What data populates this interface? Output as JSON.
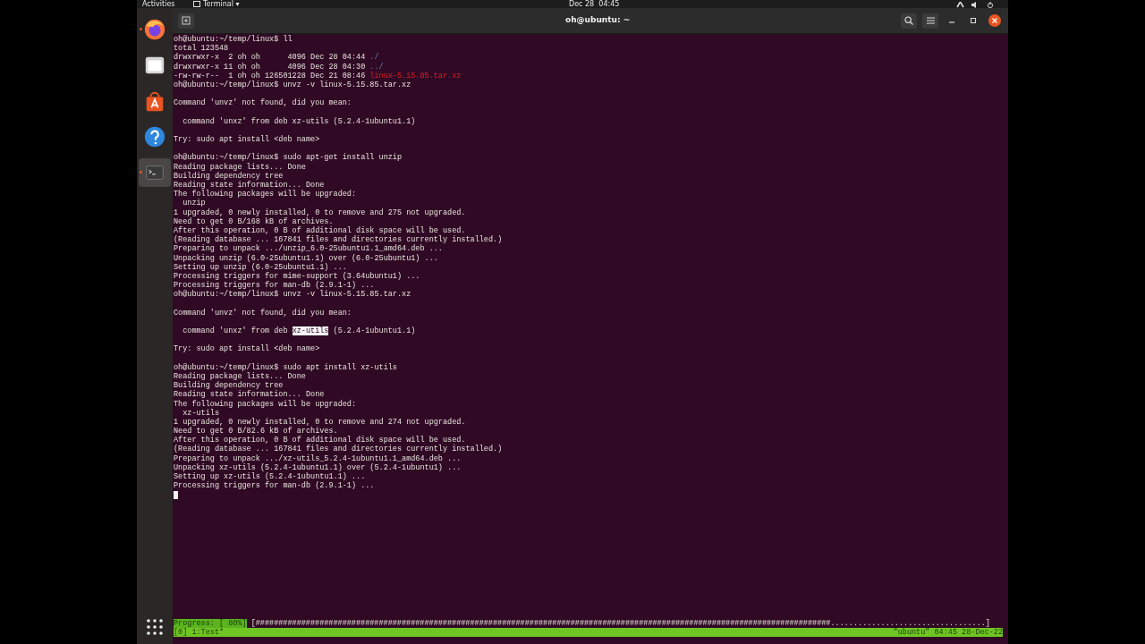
{
  "top_bar": {
    "activities": "Activities",
    "app_menu": "Terminal ▾",
    "clock": "Dec 28  04:45"
  },
  "dock": {
    "items": [
      {
        "kind": "firefox",
        "running": true,
        "selected": false
      },
      {
        "kind": "files",
        "running": false,
        "selected": false
      },
      {
        "kind": "software",
        "running": false,
        "selected": false
      },
      {
        "kind": "help",
        "running": false,
        "selected": false
      },
      {
        "kind": "terminal",
        "running": true,
        "selected": true
      }
    ]
  },
  "window": {
    "title": "oh@ubuntu: ~"
  },
  "terminal": {
    "lines": [
      {
        "text": "oh@ubuntu:~/temp/linux$ ll"
      },
      {
        "text": "total 123548"
      },
      {
        "segments": [
          {
            "text": "drwxrwxr-x  2 oh oh      4096 Dec 28 04:44 ",
            "kind": "plain"
          },
          {
            "text": "./",
            "kind": "dir"
          }
        ]
      },
      {
        "segments": [
          {
            "text": "drwxrwxr-x 11 oh oh      4096 Dec 28 04:30 ",
            "kind": "plain"
          },
          {
            "text": "../",
            "kind": "dir"
          }
        ]
      },
      {
        "segments": [
          {
            "text": "-rw-rw-r--  1 oh oh 126501228 Dec 21 08:46 ",
            "kind": "plain"
          },
          {
            "text": "linux-5.15.85.tar.xz",
            "kind": "archive"
          }
        ]
      },
      {
        "text": "oh@ubuntu:~/temp/linux$ unvz -v linux-5.15.85.tar.xz"
      },
      {
        "kind": "blank"
      },
      {
        "text": "Command 'unvz' not found, did you mean:"
      },
      {
        "kind": "blank"
      },
      {
        "text": "  command 'unxz' from deb xz-utils (5.2.4-1ubuntu1.1)"
      },
      {
        "kind": "blank"
      },
      {
        "text": "Try: sudo apt install <deb name>"
      },
      {
        "kind": "blank"
      },
      {
        "text": "oh@ubuntu:~/temp/linux$ sudo apt-get install unzip"
      },
      {
        "text": "Reading package lists... Done"
      },
      {
        "text": "Building dependency tree"
      },
      {
        "text": "Reading state information... Done"
      },
      {
        "text": "The following packages will be upgraded:"
      },
      {
        "text": "  unzip"
      },
      {
        "text": "1 upgraded, 0 newly installed, 0 to remove and 275 not upgraded."
      },
      {
        "text": "Need to get 0 B/168 kB of archives."
      },
      {
        "text": "After this operation, 0 B of additional disk space will be used."
      },
      {
        "text": "(Reading database ... 167841 files and directories currently installed.)"
      },
      {
        "text": "Preparing to unpack .../unzip_6.0-25ubuntu1.1_amd64.deb ..."
      },
      {
        "text": "Unpacking unzip (6.0-25ubuntu1.1) over (6.0-25ubuntu1) ..."
      },
      {
        "text": "Setting up unzip (6.0-25ubuntu1.1) ..."
      },
      {
        "text": "Processing triggers for mime-support (3.64ubuntu1) ..."
      },
      {
        "text": "Processing triggers for man-db (2.9.1-1) ..."
      },
      {
        "text": "oh@ubuntu:~/temp/linux$ unvz -v linux-5.15.85.tar.xz"
      },
      {
        "kind": "blank"
      },
      {
        "text": "Command 'unvz' not found, did you mean:"
      },
      {
        "kind": "blank"
      },
      {
        "segments": [
          {
            "text": "  command 'unxz' from deb ",
            "kind": "plain"
          },
          {
            "text": "xz-utils",
            "kind": "selection"
          },
          {
            "text": " (5.2.4-1ubuntu1.1)",
            "kind": "plain"
          }
        ]
      },
      {
        "kind": "blank"
      },
      {
        "text": "Try: sudo apt install <deb name>"
      },
      {
        "kind": "blank"
      },
      {
        "text": "oh@ubuntu:~/temp/linux$ sudo apt install xz-utils"
      },
      {
        "text": "Reading package lists... Done"
      },
      {
        "text": "Building dependency tree"
      },
      {
        "text": "Reading state information... Done"
      },
      {
        "text": "The following packages will be upgraded:"
      },
      {
        "text": "  xz-utils"
      },
      {
        "text": "1 upgraded, 0 newly installed, 0 to remove and 274 not upgraded."
      },
      {
        "text": "Need to get 0 B/82.6 kB of archives."
      },
      {
        "text": "After this operation, 0 B of additional disk space will be used."
      },
      {
        "text": "(Reading database ... 167841 files and directories currently installed.)"
      },
      {
        "text": "Preparing to unpack .../xz-utils_5.2.4-1ubuntu1.1_amd64.deb ..."
      },
      {
        "text": "Unpacking xz-utils (5.2.4-1ubuntu1.1) over (5.2.4-1ubuntu1) ..."
      },
      {
        "text": "Setting up xz-utils (5.2.4-1ubuntu1.1) ..."
      },
      {
        "text": "Processing triggers for man-db (2.9.1-1) ..."
      },
      {
        "kind": "cursor"
      }
    ],
    "progress": {
      "label": "Progress: [ 80%]",
      "bar": "[##############################################################################################################################..................................]"
    },
    "status_bar": {
      "left": "[0] 1:Test*",
      "right": "\"ubuntu\" 04:45 28-Dec-22"
    }
  }
}
